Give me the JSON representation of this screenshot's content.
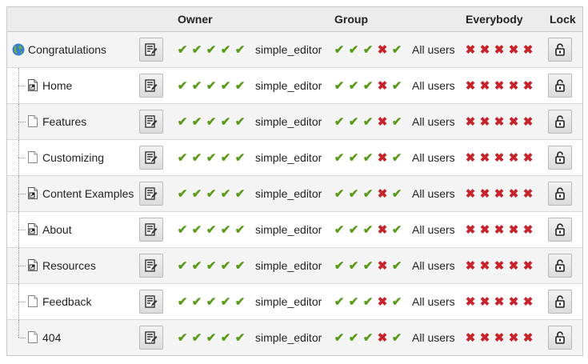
{
  "header": {
    "owner": "Owner",
    "group": "Group",
    "everybody": "Everybody",
    "lock": "Lock"
  },
  "colors": {
    "ok": "#5a9a1b",
    "no": "#c8232b"
  },
  "icons": {
    "root": "globe-icon",
    "page": "page-icon",
    "shortcut": "shortcut-page-icon",
    "edit": "edit-icon",
    "lock": "unlock-icon"
  },
  "rows": [
    {
      "name": "Congratulations",
      "icon": "globe",
      "owner": "simple_editor",
      "group_label": "All users",
      "owner_perms": [
        1,
        1,
        1,
        1,
        1
      ],
      "group_perms": [
        1,
        1,
        1,
        0,
        1
      ],
      "everybody_perms": [
        0,
        0,
        0,
        0,
        0
      ]
    },
    {
      "name": "Home",
      "icon": "shortcut",
      "owner": "simple_editor",
      "group_label": "All users",
      "owner_perms": [
        1,
        1,
        1,
        1,
        1
      ],
      "group_perms": [
        1,
        1,
        1,
        0,
        1
      ],
      "everybody_perms": [
        0,
        0,
        0,
        0,
        0
      ]
    },
    {
      "name": "Features",
      "icon": "page",
      "owner": "simple_editor",
      "group_label": "All users",
      "owner_perms": [
        1,
        1,
        1,
        1,
        1
      ],
      "group_perms": [
        1,
        1,
        1,
        0,
        1
      ],
      "everybody_perms": [
        0,
        0,
        0,
        0,
        0
      ]
    },
    {
      "name": "Customizing",
      "icon": "page",
      "owner": "simple_editor",
      "group_label": "All users",
      "owner_perms": [
        1,
        1,
        1,
        1,
        1
      ],
      "group_perms": [
        1,
        1,
        1,
        0,
        1
      ],
      "everybody_perms": [
        0,
        0,
        0,
        0,
        0
      ]
    },
    {
      "name": "Content Examples",
      "icon": "shortcut",
      "owner": "simple_editor",
      "group_label": "All users",
      "owner_perms": [
        1,
        1,
        1,
        1,
        1
      ],
      "group_perms": [
        1,
        1,
        1,
        0,
        1
      ],
      "everybody_perms": [
        0,
        0,
        0,
        0,
        0
      ]
    },
    {
      "name": "About",
      "icon": "shortcut",
      "owner": "simple_editor",
      "group_label": "All users",
      "owner_perms": [
        1,
        1,
        1,
        1,
        1
      ],
      "group_perms": [
        1,
        1,
        1,
        0,
        1
      ],
      "everybody_perms": [
        0,
        0,
        0,
        0,
        0
      ]
    },
    {
      "name": "Resources",
      "icon": "shortcut",
      "owner": "simple_editor",
      "group_label": "All users",
      "owner_perms": [
        1,
        1,
        1,
        1,
        1
      ],
      "group_perms": [
        1,
        1,
        1,
        0,
        1
      ],
      "everybody_perms": [
        0,
        0,
        0,
        0,
        0
      ]
    },
    {
      "name": "Feedback",
      "icon": "page",
      "owner": "simple_editor",
      "group_label": "All users",
      "owner_perms": [
        1,
        1,
        1,
        1,
        1
      ],
      "group_perms": [
        1,
        1,
        1,
        0,
        1
      ],
      "everybody_perms": [
        0,
        0,
        0,
        0,
        0
      ]
    },
    {
      "name": "404",
      "icon": "page",
      "owner": "simple_editor",
      "group_label": "All users",
      "owner_perms": [
        1,
        1,
        1,
        1,
        1
      ],
      "group_perms": [
        1,
        1,
        1,
        0,
        1
      ],
      "everybody_perms": [
        0,
        0,
        0,
        0,
        0
      ]
    }
  ]
}
